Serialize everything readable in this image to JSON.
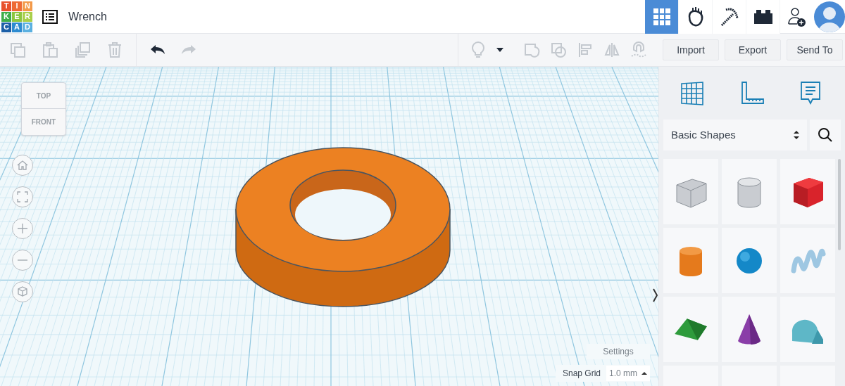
{
  "logo": {
    "letters": [
      {
        "text": "T",
        "color": "#e8512d"
      },
      {
        "text": "I",
        "color": "#ee6a35"
      },
      {
        "text": "N",
        "color": "#f39a4a"
      },
      {
        "text": "K",
        "color": "#3fae49"
      },
      {
        "text": "E",
        "color": "#8cc63f"
      },
      {
        "text": "R",
        "color": "#a9cf4a"
      },
      {
        "text": "C",
        "color": "#1d60a8"
      },
      {
        "text": "A",
        "color": "#2e8bd0"
      },
      {
        "text": "D",
        "color": "#5bb0e0"
      }
    ]
  },
  "document": {
    "title": "Wrench"
  },
  "view_modes": [
    {
      "kind": "grid",
      "selected": true
    },
    {
      "kind": "blocks",
      "selected": false
    },
    {
      "kind": "bricks",
      "selected": false
    },
    {
      "kind": "lego",
      "selected": false
    }
  ],
  "toolbar": {
    "tools": [
      {
        "kind": "copy",
        "disabled": true
      },
      {
        "kind": "paste",
        "disabled": true
      },
      {
        "kind": "duplicate",
        "disabled": true
      },
      {
        "kind": "delete",
        "disabled": true
      },
      {
        "kind": "undo",
        "disabled": false
      },
      {
        "kind": "redo",
        "disabled": true
      },
      {
        "kind": "light",
        "disabled": true
      },
      {
        "kind": "dropdown",
        "disabled": false
      },
      {
        "kind": "group",
        "disabled": true
      },
      {
        "kind": "ungroup",
        "disabled": true
      },
      {
        "kind": "align",
        "disabled": true
      },
      {
        "kind": "mirror",
        "disabled": true
      },
      {
        "kind": "magnet",
        "disabled": true
      }
    ],
    "actions": [
      "Import",
      "Export",
      "Send To"
    ]
  },
  "view_cube": {
    "top": "TOP",
    "front": "FRONT"
  },
  "nav_buttons": [
    {
      "kind": "home"
    },
    {
      "kind": "fit"
    },
    {
      "kind": "zoom_in"
    },
    {
      "kind": "zoom_out"
    },
    {
      "kind": "perspective"
    }
  ],
  "canvas": {
    "settings": "Settings",
    "snap_grid": {
      "label": "Snap Grid",
      "value": "1.0 mm"
    }
  },
  "library": {
    "tools": [
      {
        "kind": "workplane"
      },
      {
        "kind": "ruler"
      },
      {
        "kind": "notes"
      }
    ],
    "category": "Basic Shapes",
    "shapes": [
      {
        "kind": "box_hole"
      },
      {
        "kind": "cylinder_hole"
      },
      {
        "kind": "box"
      },
      {
        "kind": "cylinder"
      },
      {
        "kind": "sphere"
      },
      {
        "kind": "scribble"
      },
      {
        "kind": "roof"
      },
      {
        "kind": "cone"
      },
      {
        "kind": "round_roof"
      },
      {
        "kind": "partial"
      },
      {
        "kind": "partial"
      },
      {
        "kind": "partial"
      }
    ]
  }
}
